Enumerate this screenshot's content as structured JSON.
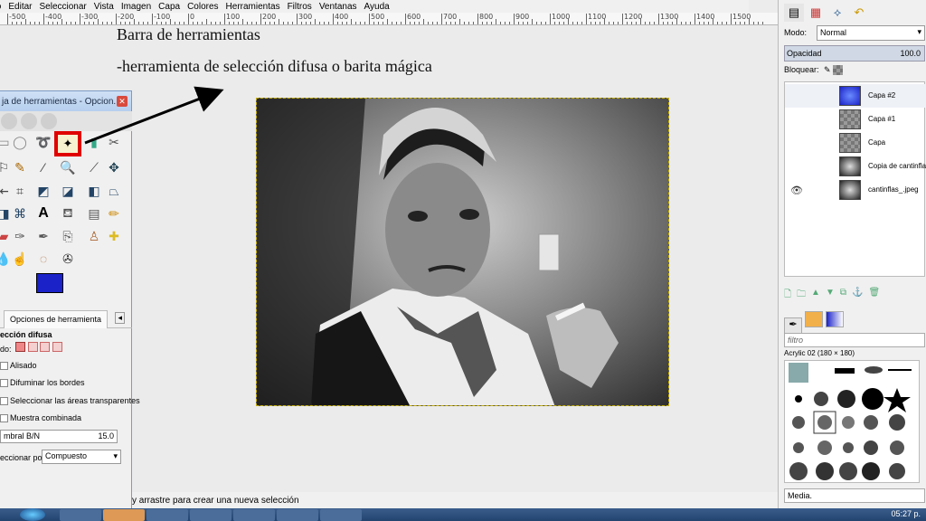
{
  "menubar": {
    "items": [
      "Archivo",
      "Editar",
      "Seleccionar",
      "Vista",
      "Imagen",
      "Capa",
      "Colores",
      "Herramientas",
      "Filtros",
      "Ventanas",
      "Ayuda"
    ]
  },
  "ruler": {
    "labels": [
      "-500",
      "-400",
      "-300",
      "-200",
      "-100",
      "0",
      "100",
      "200",
      "300",
      "400",
      "500",
      "600",
      "700",
      "800",
      "900",
      "1000",
      "1100",
      "1200",
      "1300",
      "1400",
      "1500"
    ]
  },
  "annotation": {
    "line1": "Barra de herramientas",
    "line2": "-herramienta de selección difusa o barita mágica"
  },
  "toolbox": {
    "title": "ja de herramientas - Opcion...",
    "options_tab": "Opciones de herramienta",
    "tool_name": "ección difusa",
    "mode_label": "do:",
    "antialias": "Alisado",
    "feather": "Difuminar los bordes",
    "transparent": "Seleccionar las áreas transparentes",
    "merged": "Muestra combinada",
    "threshold_label": "mbral B/N",
    "threshold_value": "15.0",
    "select_by_label": "eccionar por:",
    "select_by_value": "Compuesto"
  },
  "statusbar": {
    "text": "y arrastre para crear una nueva selección"
  },
  "layers_panel": {
    "mode_label": "Modo:",
    "mode_value": "Normal",
    "opacity_label": "Opacidad",
    "opacity_value": "100.0",
    "lock_label": "Bloquear:",
    "layers": [
      {
        "name": "Capa #2",
        "thumb": "blue",
        "visible": false
      },
      {
        "name": "Capa #1",
        "thumb": "checker",
        "visible": false
      },
      {
        "name": "Capa",
        "thumb": "checker",
        "visible": false
      },
      {
        "name": "Copia de cantinflas",
        "thumb": "photo",
        "visible": false
      },
      {
        "name": "cantinflas_.jpeg",
        "thumb": "photo",
        "visible": true
      }
    ]
  },
  "brushes_panel": {
    "filter_placeholder": "filtro",
    "brush_name": "Acrylic 02 (180 × 180)",
    "media_label": "Media."
  },
  "taskbar": {
    "clock": "05:27 p."
  },
  "colors": {
    "foreground": "#1a22c8",
    "background": "#ffffff",
    "highlight": "#e00000",
    "accent": "#3a5d8c"
  }
}
